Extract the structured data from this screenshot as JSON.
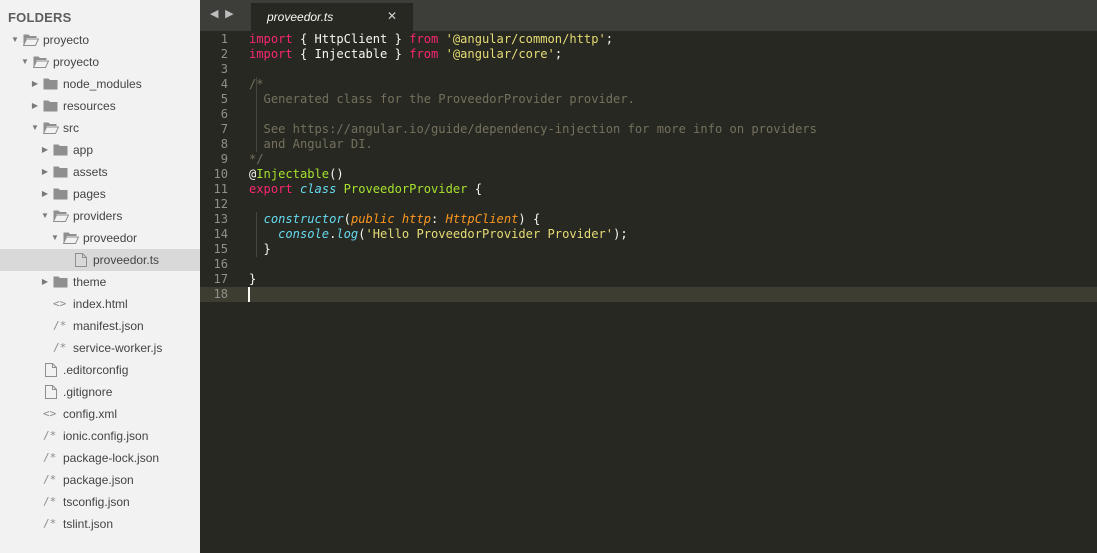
{
  "colors": {
    "sidebar_bg": "#f2f2f2",
    "selected_row": "#d9d9d9",
    "editor_bg": "#272822",
    "keyword": "#f92672",
    "string": "#e6db74",
    "comment": "#75715e",
    "function": "#a6e22e",
    "type": "#66d9ef",
    "parameter": "#fd971f"
  },
  "sidebar": {
    "header": "FOLDERS",
    "items": [
      {
        "label": "proyecto",
        "kind": "folder",
        "expanded": true,
        "depth": 0,
        "icon": "folder-open-icon"
      },
      {
        "label": "proyecto",
        "kind": "folder",
        "expanded": true,
        "depth": 1,
        "icon": "folder-open-icon"
      },
      {
        "label": "node_modules",
        "kind": "folder",
        "expanded": false,
        "depth": 2,
        "icon": "folder-icon"
      },
      {
        "label": "resources",
        "kind": "folder",
        "expanded": false,
        "depth": 2,
        "icon": "folder-icon"
      },
      {
        "label": "src",
        "kind": "folder",
        "expanded": true,
        "depth": 2,
        "icon": "folder-open-icon"
      },
      {
        "label": "app",
        "kind": "folder",
        "expanded": false,
        "depth": 3,
        "icon": "folder-icon"
      },
      {
        "label": "assets",
        "kind": "folder",
        "expanded": false,
        "depth": 3,
        "icon": "folder-icon"
      },
      {
        "label": "pages",
        "kind": "folder",
        "expanded": false,
        "depth": 3,
        "icon": "folder-icon"
      },
      {
        "label": "providers",
        "kind": "folder",
        "expanded": true,
        "depth": 3,
        "icon": "folder-open-icon"
      },
      {
        "label": "proveedor",
        "kind": "folder",
        "expanded": true,
        "depth": 4,
        "icon": "folder-open-icon"
      },
      {
        "label": "proveedor.ts",
        "kind": "file",
        "depth": 5,
        "icon": "file-icon",
        "selected": true
      },
      {
        "label": "theme",
        "kind": "folder",
        "expanded": false,
        "depth": 3,
        "icon": "folder-icon"
      },
      {
        "label": "index.html",
        "kind": "file",
        "depth": 3,
        "icon": "code-icon",
        "glyph": "<>"
      },
      {
        "label": "manifest.json",
        "kind": "file",
        "depth": 3,
        "icon": "comment-icon",
        "glyph": "/*"
      },
      {
        "label": "service-worker.js",
        "kind": "file",
        "depth": 3,
        "icon": "comment-icon",
        "glyph": "/*"
      },
      {
        "label": ".editorconfig",
        "kind": "file",
        "depth": 2,
        "icon": "file-icon"
      },
      {
        "label": ".gitignore",
        "kind": "file",
        "depth": 2,
        "icon": "file-icon"
      },
      {
        "label": "config.xml",
        "kind": "file",
        "depth": 2,
        "icon": "code-icon",
        "glyph": "<>"
      },
      {
        "label": "ionic.config.json",
        "kind": "file",
        "depth": 2,
        "icon": "comment-icon",
        "glyph": "/*"
      },
      {
        "label": "package-lock.json",
        "kind": "file",
        "depth": 2,
        "icon": "comment-icon",
        "glyph": "/*"
      },
      {
        "label": "package.json",
        "kind": "file",
        "depth": 2,
        "icon": "comment-icon",
        "glyph": "/*"
      },
      {
        "label": "tsconfig.json",
        "kind": "file",
        "depth": 2,
        "icon": "comment-icon",
        "glyph": "/*"
      },
      {
        "label": "tslint.json",
        "kind": "file",
        "depth": 2,
        "icon": "comment-icon",
        "glyph": "/*"
      }
    ]
  },
  "tabs": {
    "nav_prev": "◀",
    "nav_next": "▶",
    "active": {
      "label": "proveedor.ts",
      "close": "✕"
    }
  },
  "editor": {
    "current_line": 18,
    "lines": [
      [
        [
          "kw",
          "import"
        ],
        [
          "pln",
          " { HttpClient } "
        ],
        [
          "kw",
          "from"
        ],
        [
          "pln",
          " "
        ],
        [
          "str",
          "'@angular/common/http'"
        ],
        [
          "pln",
          ";"
        ]
      ],
      [
        [
          "kw",
          "import"
        ],
        [
          "pln",
          " { Injectable } "
        ],
        [
          "kw",
          "from"
        ],
        [
          "pln",
          " "
        ],
        [
          "str",
          "'@angular/core'"
        ],
        [
          "pln",
          ";"
        ]
      ],
      [],
      [
        [
          "cmt",
          "/*"
        ]
      ],
      [
        [
          "cmt",
          "  Generated class for the ProveedorProvider provider."
        ]
      ],
      [],
      [
        [
          "cmt",
          "  See https://angular.io/guide/dependency-injection for more info on providers"
        ]
      ],
      [
        [
          "cmt",
          "  and Angular DI."
        ]
      ],
      [
        [
          "cmt",
          "*/"
        ]
      ],
      [
        [
          "pln",
          "@"
        ],
        [
          "dec",
          "Injectable"
        ],
        [
          "pln",
          "()"
        ]
      ],
      [
        [
          "kw",
          "export"
        ],
        [
          "pln",
          " "
        ],
        [
          "ty",
          "class"
        ],
        [
          "pln",
          " "
        ],
        [
          "cls",
          "ProveedorProvider"
        ],
        [
          "pln",
          " {"
        ]
      ],
      [],
      [
        [
          "pln",
          "  "
        ],
        [
          "ty",
          "constructor"
        ],
        [
          "pln",
          "("
        ],
        [
          "param",
          "public"
        ],
        [
          "pln",
          " "
        ],
        [
          "param",
          "http"
        ],
        [
          "pln",
          ": "
        ],
        [
          "param",
          "HttpClient"
        ],
        [
          "pln",
          ") {"
        ]
      ],
      [
        [
          "pln",
          "    "
        ],
        [
          "ty",
          "console"
        ],
        [
          "pln",
          "."
        ],
        [
          "ty",
          "log"
        ],
        [
          "pln",
          "("
        ],
        [
          "str",
          "'Hello ProveedorProvider Provider'"
        ],
        [
          "pln",
          ");"
        ]
      ],
      [
        [
          "pln",
          "  }"
        ]
      ],
      [],
      [
        [
          "pln",
          "}"
        ]
      ],
      []
    ]
  }
}
